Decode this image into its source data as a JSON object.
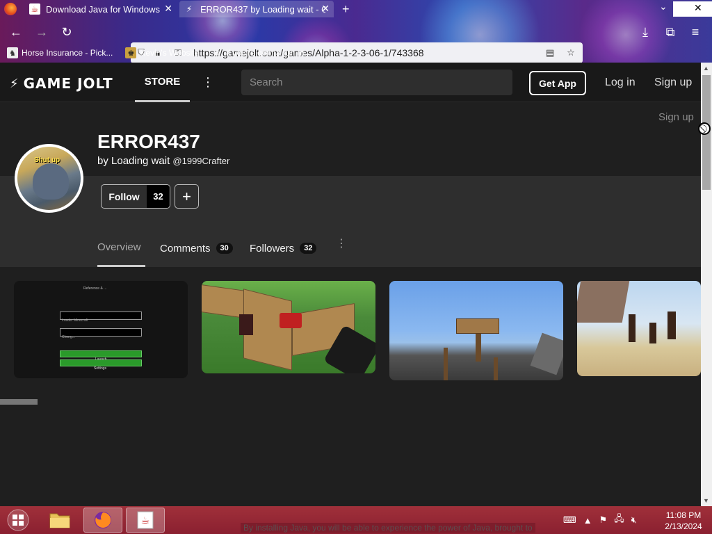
{
  "browser": {
    "tabs": [
      {
        "title": "Download Java for Windows",
        "icon": "java-icon"
      },
      {
        "title": "ERROR437 by Loading wait - Ga",
        "icon": "gamejolt-icon"
      }
    ],
    "new_tab": "+",
    "tab_overflow": "⌄",
    "url": "https://gamejolt.com/games/Alpha-1-2-3-06-1/743368",
    "bookmarks": [
      {
        "label": "Horse Insurance - Pick...",
        "icon": "horse-icon"
      },
      {
        "label": "Kevin's Website",
        "icon": "site-icon"
      },
      {
        "label": "if you're gonna run m...",
        "icon": "skull-icon"
      }
    ]
  },
  "header": {
    "logo": "GAME JOLT",
    "store": "STORE",
    "search_placeholder": "Search",
    "get_app": "Get App",
    "login": "Log in",
    "signup": "Sign up"
  },
  "profile": {
    "signup_ghost": "Sign up",
    "avatar_caption": "Shut up",
    "title": "ERROR437",
    "by_prefix": "by",
    "author": "Loading wait",
    "handle": "@1999Crafter",
    "follow_label": "Follow",
    "follow_count": "32",
    "plus": "+",
    "tabs": [
      {
        "label": "Overview",
        "count": ""
      },
      {
        "label": "Comments",
        "count": "30"
      },
      {
        "label": "Followers",
        "count": "32"
      }
    ]
  },
  "media": {
    "screenshot1": {
      "title": "Reference & ...",
      "field1": "Loader Minecraft",
      "field2": "Cheng...",
      "btn1": "Launch",
      "btn2": "Settings"
    }
  },
  "taskbar": {
    "install_message": "By installing Java, you will be able to experience the power of Java, brought to",
    "time": "11:08 PM",
    "date": "2/13/2024"
  },
  "colors": {
    "accent": "#ffffff",
    "taskbar": "#9a2a36",
    "page_bg": "#1f1f1f"
  }
}
